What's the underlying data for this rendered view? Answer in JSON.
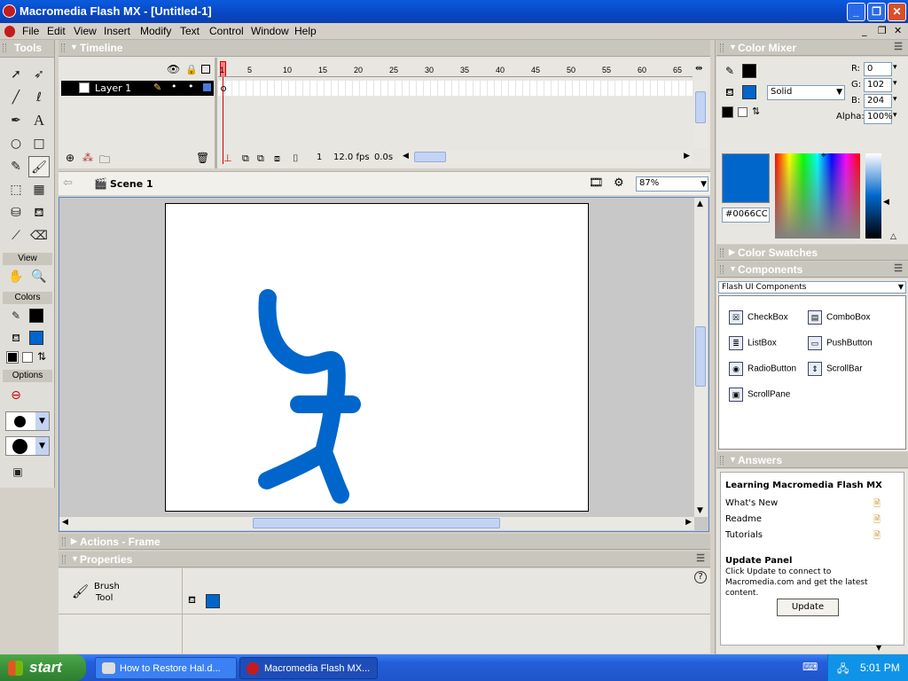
{
  "window": {
    "title": "Macromedia Flash MX - [Untitled-1]"
  },
  "menu": [
    "File",
    "Edit",
    "View",
    "Insert",
    "Modify",
    "Text",
    "Control",
    "Window",
    "Help"
  ],
  "tools": {
    "header": "Tools",
    "view_label": "View",
    "colors_label": "Colors",
    "options_label": "Options"
  },
  "timeline": {
    "header": "Timeline",
    "layer_name": "Layer 1",
    "ticks": [
      "1",
      "5",
      "10",
      "15",
      "20",
      "25",
      "30",
      "35",
      "40",
      "45",
      "50",
      "55",
      "60",
      "65"
    ],
    "current_frame": "1",
    "fps": "12.0 fps",
    "elapsed": "0.0s"
  },
  "scene": {
    "name": "Scene 1",
    "zoom": "87%"
  },
  "panels": {
    "actions": "Actions - Frame",
    "properties": "Properties",
    "prop_tool_line1": "Brush",
    "prop_tool_line2": "Tool"
  },
  "color_mixer": {
    "header": "Color Mixer",
    "fill_type": "Solid",
    "r_label": "R:",
    "r": "0",
    "g_label": "G:",
    "g": "102",
    "b_label": "B:",
    "b": "204",
    "alpha_label": "Alpha:",
    "alpha": "100%",
    "hex": "#0066CC",
    "fill_color": "#0066CC",
    "stroke_color": "#000000"
  },
  "color_swatches": {
    "header": "Color Swatches"
  },
  "components": {
    "header": "Components",
    "set": "Flash UI Components",
    "items": [
      "CheckBox",
      "ComboBox",
      "ListBox",
      "PushButton",
      "RadioButton",
      "ScrollBar",
      "ScrollPane"
    ]
  },
  "answers": {
    "header": "Answers",
    "title": "Learning Macromedia Flash MX",
    "links": [
      "What's New",
      "Readme",
      "Tutorials"
    ],
    "update_title": "Update Panel",
    "update_text": "Click Update to connect to Macromedia.com and get the latest content.",
    "update_button": "Update"
  },
  "taskbar": {
    "start": "start",
    "tasks": [
      "How to Restore Hal.d...",
      "Macromedia Flash MX..."
    ],
    "clock": "5:01 PM"
  },
  "icons": [
    "flash-app-icon",
    "arrow-tool-icon",
    "subselect-tool-icon",
    "line-tool-icon",
    "lasso-tool-icon",
    "pen-tool-icon",
    "text-tool-icon",
    "oval-tool-icon",
    "rectangle-tool-icon",
    "pencil-tool-icon",
    "brush-tool-icon",
    "free-transform-icon",
    "fill-transform-icon",
    "ink-bottle-icon",
    "paint-bucket-icon",
    "eyedropper-icon",
    "eraser-icon",
    "hand-tool-icon",
    "zoom-tool-icon"
  ]
}
